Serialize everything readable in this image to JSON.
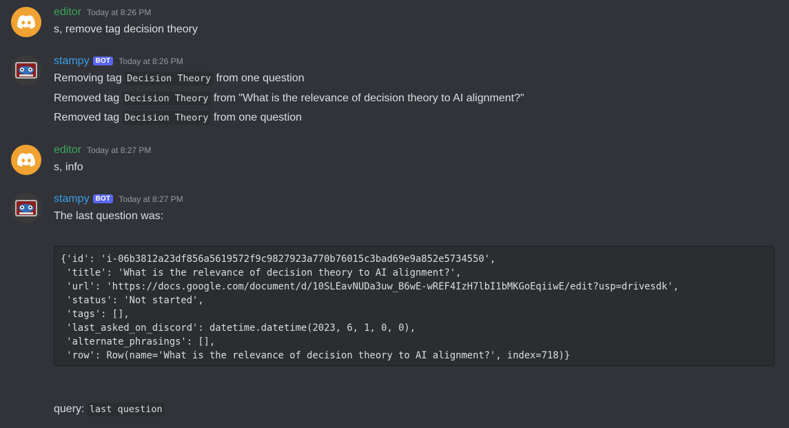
{
  "messages": [
    {
      "author": "editor",
      "timestamp": "Today at 8:26 PM",
      "text": "s, remove tag decision theory"
    },
    {
      "author": "stampy",
      "bot_tag": "BOT",
      "timestamp": "Today at 8:26 PM",
      "lines": [
        {
          "pre": "Removing tag ",
          "code": "Decision Theory",
          "post": " from one question"
        },
        {
          "pre": "Removed tag ",
          "code": "Decision Theory",
          "post": " from \"What is the relevance of decision theory to AI alignment?\""
        },
        {
          "pre": "Removed tag ",
          "code": "Decision Theory",
          "post": " from one question"
        }
      ]
    },
    {
      "author": "editor",
      "timestamp": "Today at 8:27 PM",
      "text": "s, info"
    },
    {
      "author": "stampy",
      "bot_tag": "BOT",
      "timestamp": "Today at 8:27 PM",
      "text": "The last question was:",
      "code_lines": [
        "{'id': 'i-06b3812a23df856a5619572f9c9827923a770b76015c3bad69e9a852e5734550',",
        " 'title': 'What is the relevance of decision theory to AI alignment?',",
        " 'url': 'https://docs.google.com/document/d/10SLEavNUDa3uw_B6wE-wREF4IzH7lbI1bMKGoEqiiwE/edit?usp=drivesdk',",
        " 'status': 'Not started',",
        " 'tags': [],",
        " 'last_asked_on_discord': datetime.datetime(2023, 6, 1, 0, 0),",
        " 'alternate_phrasings': [],",
        " 'row': Row(name='What is the relevance of decision theory to AI alignment?', index=718)}"
      ],
      "query_label": "query: ",
      "query_code": "last question"
    }
  ],
  "colors": {
    "background": "#313338",
    "editor_name": "#3ba55d",
    "stampy_name": "#3c9ee8",
    "bot_tag": "#5865f2",
    "code_bg": "#2b2d31",
    "discord_avatar": "#f0a232"
  },
  "icons": {
    "editor_avatar": "discord-logo-icon",
    "stampy_avatar": "robot-avatar-icon"
  }
}
